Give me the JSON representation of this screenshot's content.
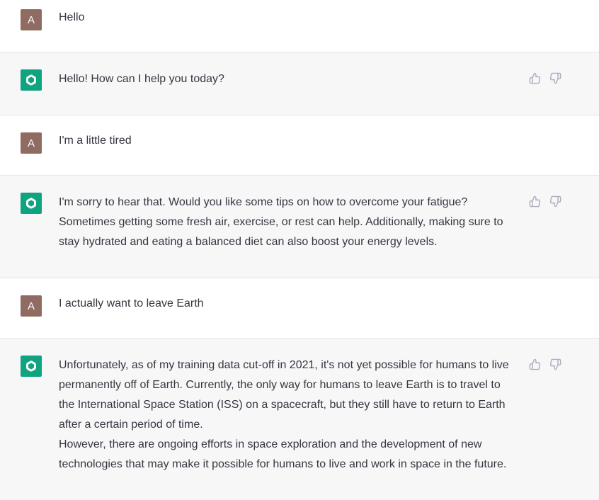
{
  "conversation": {
    "messages": [
      {
        "role": "user",
        "avatar_letter": "A",
        "text": [
          "Hello"
        ]
      },
      {
        "role": "assistant",
        "avatar_icon": "chatgpt-logo-icon",
        "text": [
          "Hello! How can I help you today?"
        ]
      },
      {
        "role": "user",
        "avatar_letter": "A",
        "text": [
          "I'm a little tired"
        ]
      },
      {
        "role": "assistant",
        "avatar_icon": "chatgpt-logo-icon",
        "text": [
          "I'm sorry to hear that. Would you like some tips on how to overcome your fatigue? Sometimes getting some fresh air, exercise, or rest can help. Additionally, making sure to stay hydrated and eating a balanced diet can also boost your energy levels."
        ]
      },
      {
        "role": "user",
        "avatar_letter": "A",
        "text": [
          "I actually want to leave Earth"
        ]
      },
      {
        "role": "assistant",
        "avatar_icon": "chatgpt-logo-icon",
        "text": [
          "Unfortunately, as of my training data cut-off in 2021, it's not yet possible for humans to live permanently off of Earth. Currently, the only way for humans to leave Earth is to travel to the International Space Station (ISS) on a spacecraft, but they still have to return to Earth after a certain period of time.",
          "However, there are ongoing efforts in space exploration and the development of new technologies that may make it possible for humans to live and work in space in the future."
        ]
      }
    ]
  },
  "colors": {
    "user_avatar_bg": "#8f6b62",
    "assistant_avatar_bg": "#10a37f",
    "assistant_row_bg": "#f7f7f8",
    "text": "#353740",
    "icon_gray": "#acacbe"
  }
}
